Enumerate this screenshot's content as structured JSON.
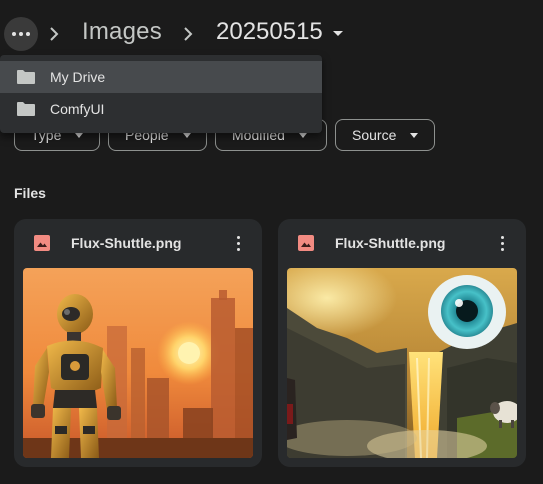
{
  "breadcrumb": {
    "more_icon": "more-horiz-icon",
    "items": [
      "Images",
      "20250515"
    ]
  },
  "menu": {
    "items": [
      {
        "label": "My Drive",
        "icon": "folder-icon"
      },
      {
        "label": "ComfyUI",
        "icon": "folder-icon"
      }
    ]
  },
  "filters": [
    "Type",
    "People",
    "Modified",
    "Source"
  ],
  "section": {
    "title": "Files"
  },
  "files": [
    {
      "name": "Flux-Shuttle.png",
      "icon": "image-file-icon"
    },
    {
      "name": "Flux-Shuttle.png",
      "icon": "image-file-icon"
    }
  ],
  "colors": {
    "background": "#1b1b1b",
    "card": "#282a2c",
    "menu": "#2d2f31",
    "image_icon": "#f28b82"
  }
}
